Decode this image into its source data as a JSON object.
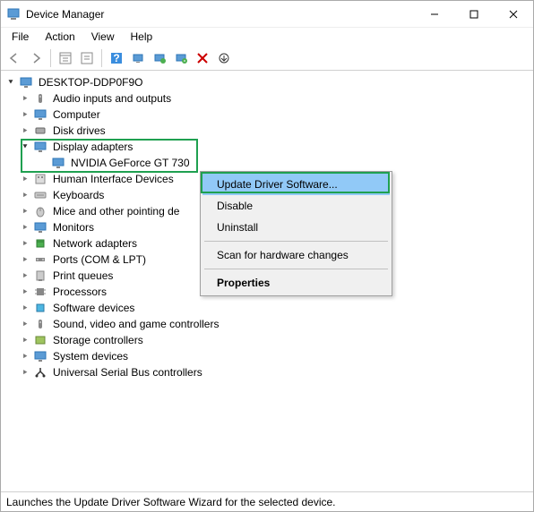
{
  "title": "Device Manager",
  "menu": [
    "File",
    "Action",
    "View",
    "Help"
  ],
  "root_node": "DESKTOP-DDP0F9O",
  "categories": [
    "Audio inputs and outputs",
    "Computer",
    "Disk drives",
    "Display adapters",
    "Human Interface Devices",
    "Keyboards",
    "Mice and other pointing de",
    "Monitors",
    "Network adapters",
    "Ports (COM & LPT)",
    "Print queues",
    "Processors",
    "Software devices",
    "Sound, video and game controllers",
    "Storage controllers",
    "System devices",
    "Universal Serial Bus controllers"
  ],
  "display_adapter_child": "NVIDIA GeForce GT 730",
  "context_menu": {
    "update": "Update Driver Software...",
    "disable": "Disable",
    "uninstall": "Uninstall",
    "scan": "Scan for hardware changes",
    "properties": "Properties"
  },
  "status": "Launches the Update Driver Software Wizard for the selected device."
}
